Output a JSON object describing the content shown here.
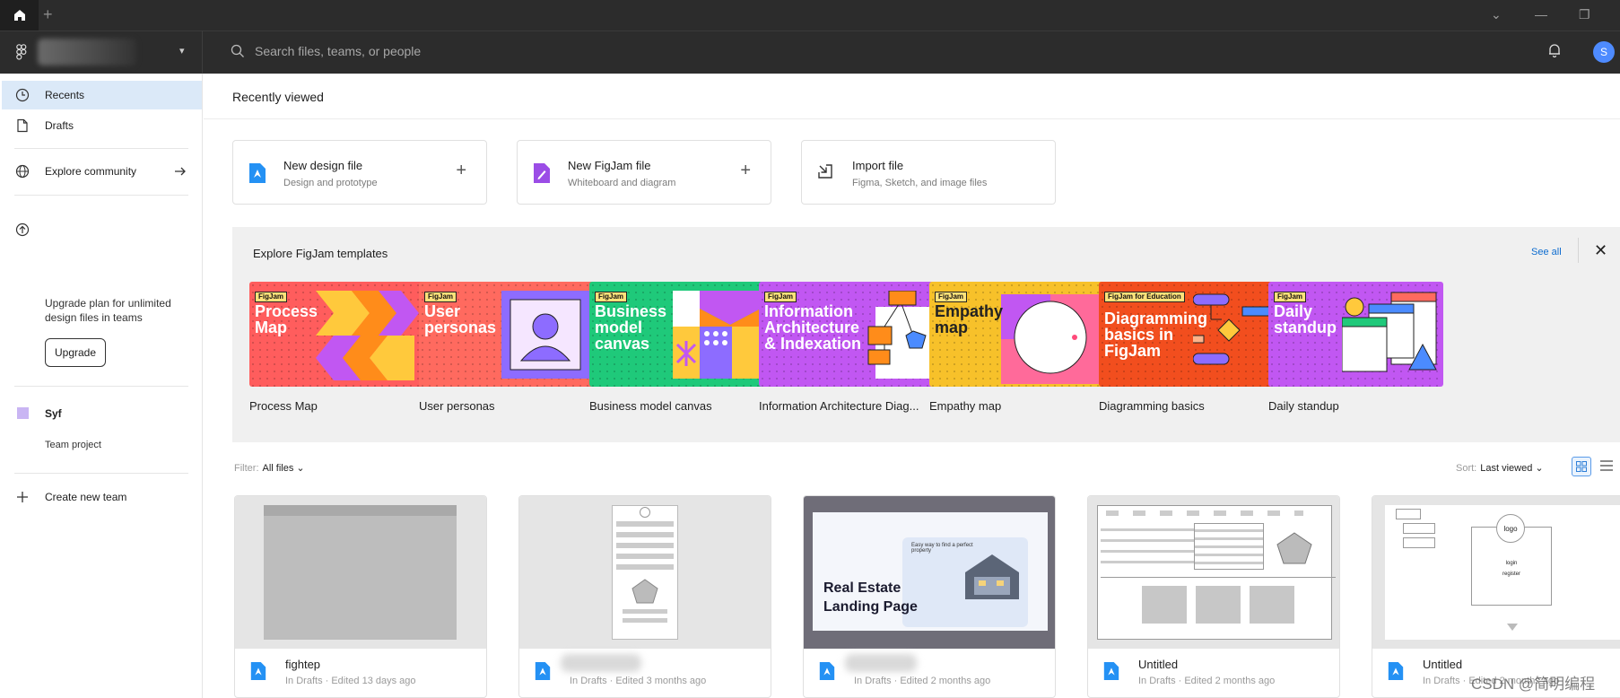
{
  "titlebar": {
    "new_tab": "+",
    "controls": [
      "⌄",
      "—",
      "❐"
    ]
  },
  "search": {
    "placeholder": "Search files, teams, or people"
  },
  "user": {
    "avatar_letter": "S"
  },
  "sidebar": {
    "items": [
      {
        "label": "Recents",
        "icon": "clock-icon"
      },
      {
        "label": "Drafts",
        "icon": "file-icon"
      },
      {
        "label": "Explore community",
        "icon": "globe-icon"
      }
    ],
    "upgrade_text": "Upgrade plan for unlimited design files in teams",
    "upgrade_button": "Upgrade",
    "team_name": "Syf",
    "team_project": "Team project",
    "create_team": "Create new team"
  },
  "main": {
    "recently_viewed": "Recently viewed",
    "actions": [
      {
        "title": "New design file",
        "subtitle": "Design and prototype",
        "plus": "+"
      },
      {
        "title": "New FigJam file",
        "subtitle": "Whiteboard and diagram",
        "plus": "+"
      },
      {
        "title": "Import file",
        "subtitle": "Figma, Sketch, and image files"
      }
    ],
    "templates": {
      "title": "Explore FigJam templates",
      "see_all": "See all",
      "close": "✕",
      "items": [
        {
          "name": "Process Map",
          "badge": "FigJam",
          "card_title": "Process Map",
          "color": "#ff5d5d"
        },
        {
          "name": "User personas",
          "badge": "FigJam",
          "card_title": "User personas",
          "color": "#ff6a5f"
        },
        {
          "name": "Business model canvas",
          "badge": "FigJam",
          "card_title": "Business model canvas",
          "color": "#1fc97a"
        },
        {
          "name": "Information Architecture Diag...",
          "badge": "FigJam",
          "card_title": "Information Architecture & Indexation",
          "color": "#c157f2"
        },
        {
          "name": "Empathy map",
          "badge": "FigJam",
          "card_title": "Empathy map",
          "color": "#f7c12a"
        },
        {
          "name": "Diagramming basics",
          "badge": "FigJam for Education",
          "card_title": "Diagramming basics in FigJam",
          "color": "#f24e1e"
        },
        {
          "name": "Daily standup",
          "badge": "FigJam",
          "card_title": "Daily standup",
          "color": "#c157f2"
        }
      ]
    },
    "filter": {
      "label": "Filter:",
      "value": "All files ⌄"
    },
    "sort": {
      "label": "Sort:",
      "value": "Last viewed ⌄"
    },
    "files": [
      {
        "name": "fightep",
        "meta": "In Drafts · Edited 13 days ago"
      },
      {
        "name": "",
        "meta": "In Drafts · Edited 3 months ago"
      },
      {
        "name": "",
        "meta": "In Drafts · Edited 2 months ago",
        "thumb_title": "Real Estate Landing Page",
        "thumb_sub": "Easy way to find a perfect property"
      },
      {
        "name": "Untitled",
        "meta": "In Drafts · Edited 2 months ago"
      },
      {
        "name": "Untitled",
        "meta": "In Drafts · Edited 2 months ago",
        "thumb_labels": [
          "logo",
          "login",
          "register"
        ]
      }
    ]
  },
  "watermark": "CSDN @简明编程"
}
